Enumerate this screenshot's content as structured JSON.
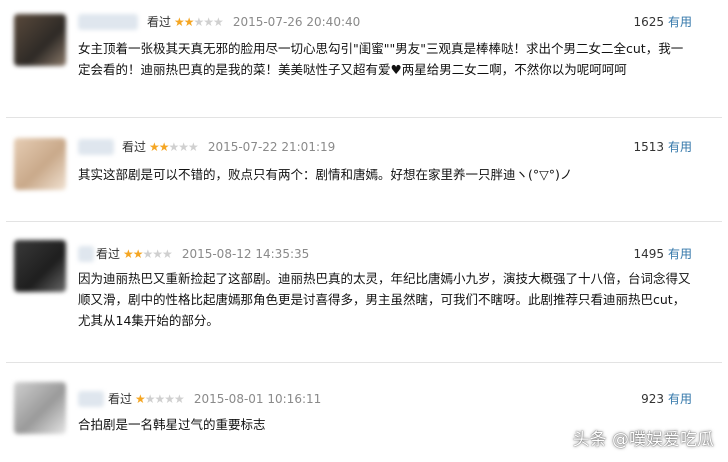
{
  "reviews": [
    {
      "watched": "看过",
      "stars_on": "★★",
      "stars_off": "★★★",
      "rating": 2,
      "time": "2015-07-26 20:40:40",
      "useful_count": "1625",
      "useful_label": "有用",
      "content": "女主顶着一张极其天真无邪的脸用尽一切心思勾引\"闺蜜\"\"男友\"三观真是棒棒哒！求出个男二女二全cut，我一定会看的！迪丽热巴真的是我的菜！美美哒性子又超有爱♥两星给男二女二啊，不然你以为呢呵呵呵"
    },
    {
      "watched": "看过",
      "stars_on": "★★",
      "stars_off": "★★★",
      "rating": 2,
      "time": "2015-07-22 21:01:19",
      "useful_count": "1513",
      "useful_label": "有用",
      "content": "其实这部剧是可以不错的，败点只有两个：剧情和唐嫣。好想在家里养一只胖迪ヽ(°▽°)ノ"
    },
    {
      "watched": "看过",
      "stars_on": "★★",
      "stars_off": "★★★",
      "rating": 2,
      "time": "2015-08-12 14:35:35",
      "useful_count": "1495",
      "useful_label": "有用",
      "content": "因为迪丽热巴又重新捡起了这部剧。迪丽热巴真的太灵，年纪比唐嫣小九岁，演技大概强了十八倍，台词念得又顺又滑，剧中的性格比起唐嫣那角色更是讨喜得多，男主虽然瞎，可我们不瞎呀。此剧推荐只看迪丽热巴cut，尤其从14集开始的部分。"
    },
    {
      "watched": "看过",
      "stars_on": "★",
      "stars_off": "★★★★",
      "rating": 1,
      "time": "2015-08-01 10:16:11",
      "useful_count": "923",
      "useful_label": "有用",
      "content": "合拍剧是一名韩星过气的重要标志"
    }
  ],
  "watermark": "头条 @噗娱爱吃瓜"
}
